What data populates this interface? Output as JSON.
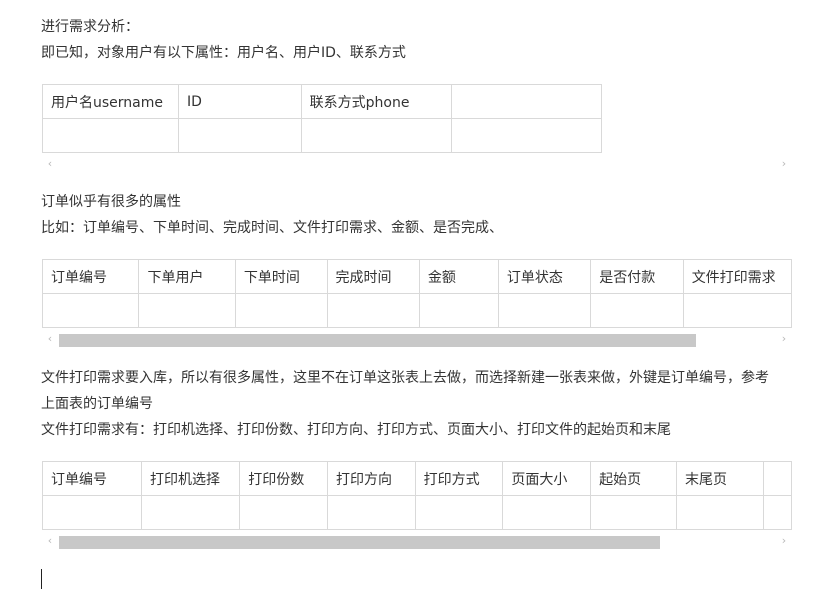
{
  "paragraphs": {
    "p1": "进行需求分析：",
    "p2": "即已知，对象用户有以下属性：用户名、用户ID、联系方式",
    "p3": "订单似乎有很多的属性",
    "p4": "比如：订单编号、下单时间、完成时间、文件打印需求、金额、是否完成、",
    "p5": "文件打印需求要入库，所以有很多属性，这里不在订单这张表上去做，而选择新建一张表来做，外键是订单编号，参考上面表的订单编号",
    "p6": "文件打印需求有：打印机选择、打印份数、打印方向、打印方式、页面大小、打印文件的起始页和末尾"
  },
  "table_user": {
    "headers": [
      "用户名username",
      "ID",
      "联系方式phone",
      ""
    ]
  },
  "table_order": {
    "headers": [
      "订单编号",
      "下单用户",
      "下单时间",
      "完成时间",
      "金额",
      "订单状态",
      "是否付款",
      "文件打印需求"
    ]
  },
  "table_print": {
    "headers": [
      "订单编号",
      "打印机选择",
      "打印份数",
      "打印方向",
      "打印方式",
      "页面大小",
      "起始页",
      "末尾页",
      ""
    ]
  },
  "scrollbars": {
    "left_arrow": "‹",
    "right_arrow": "›",
    "order_thumb_fraction": 0.89,
    "print_thumb_fraction": 0.84
  }
}
